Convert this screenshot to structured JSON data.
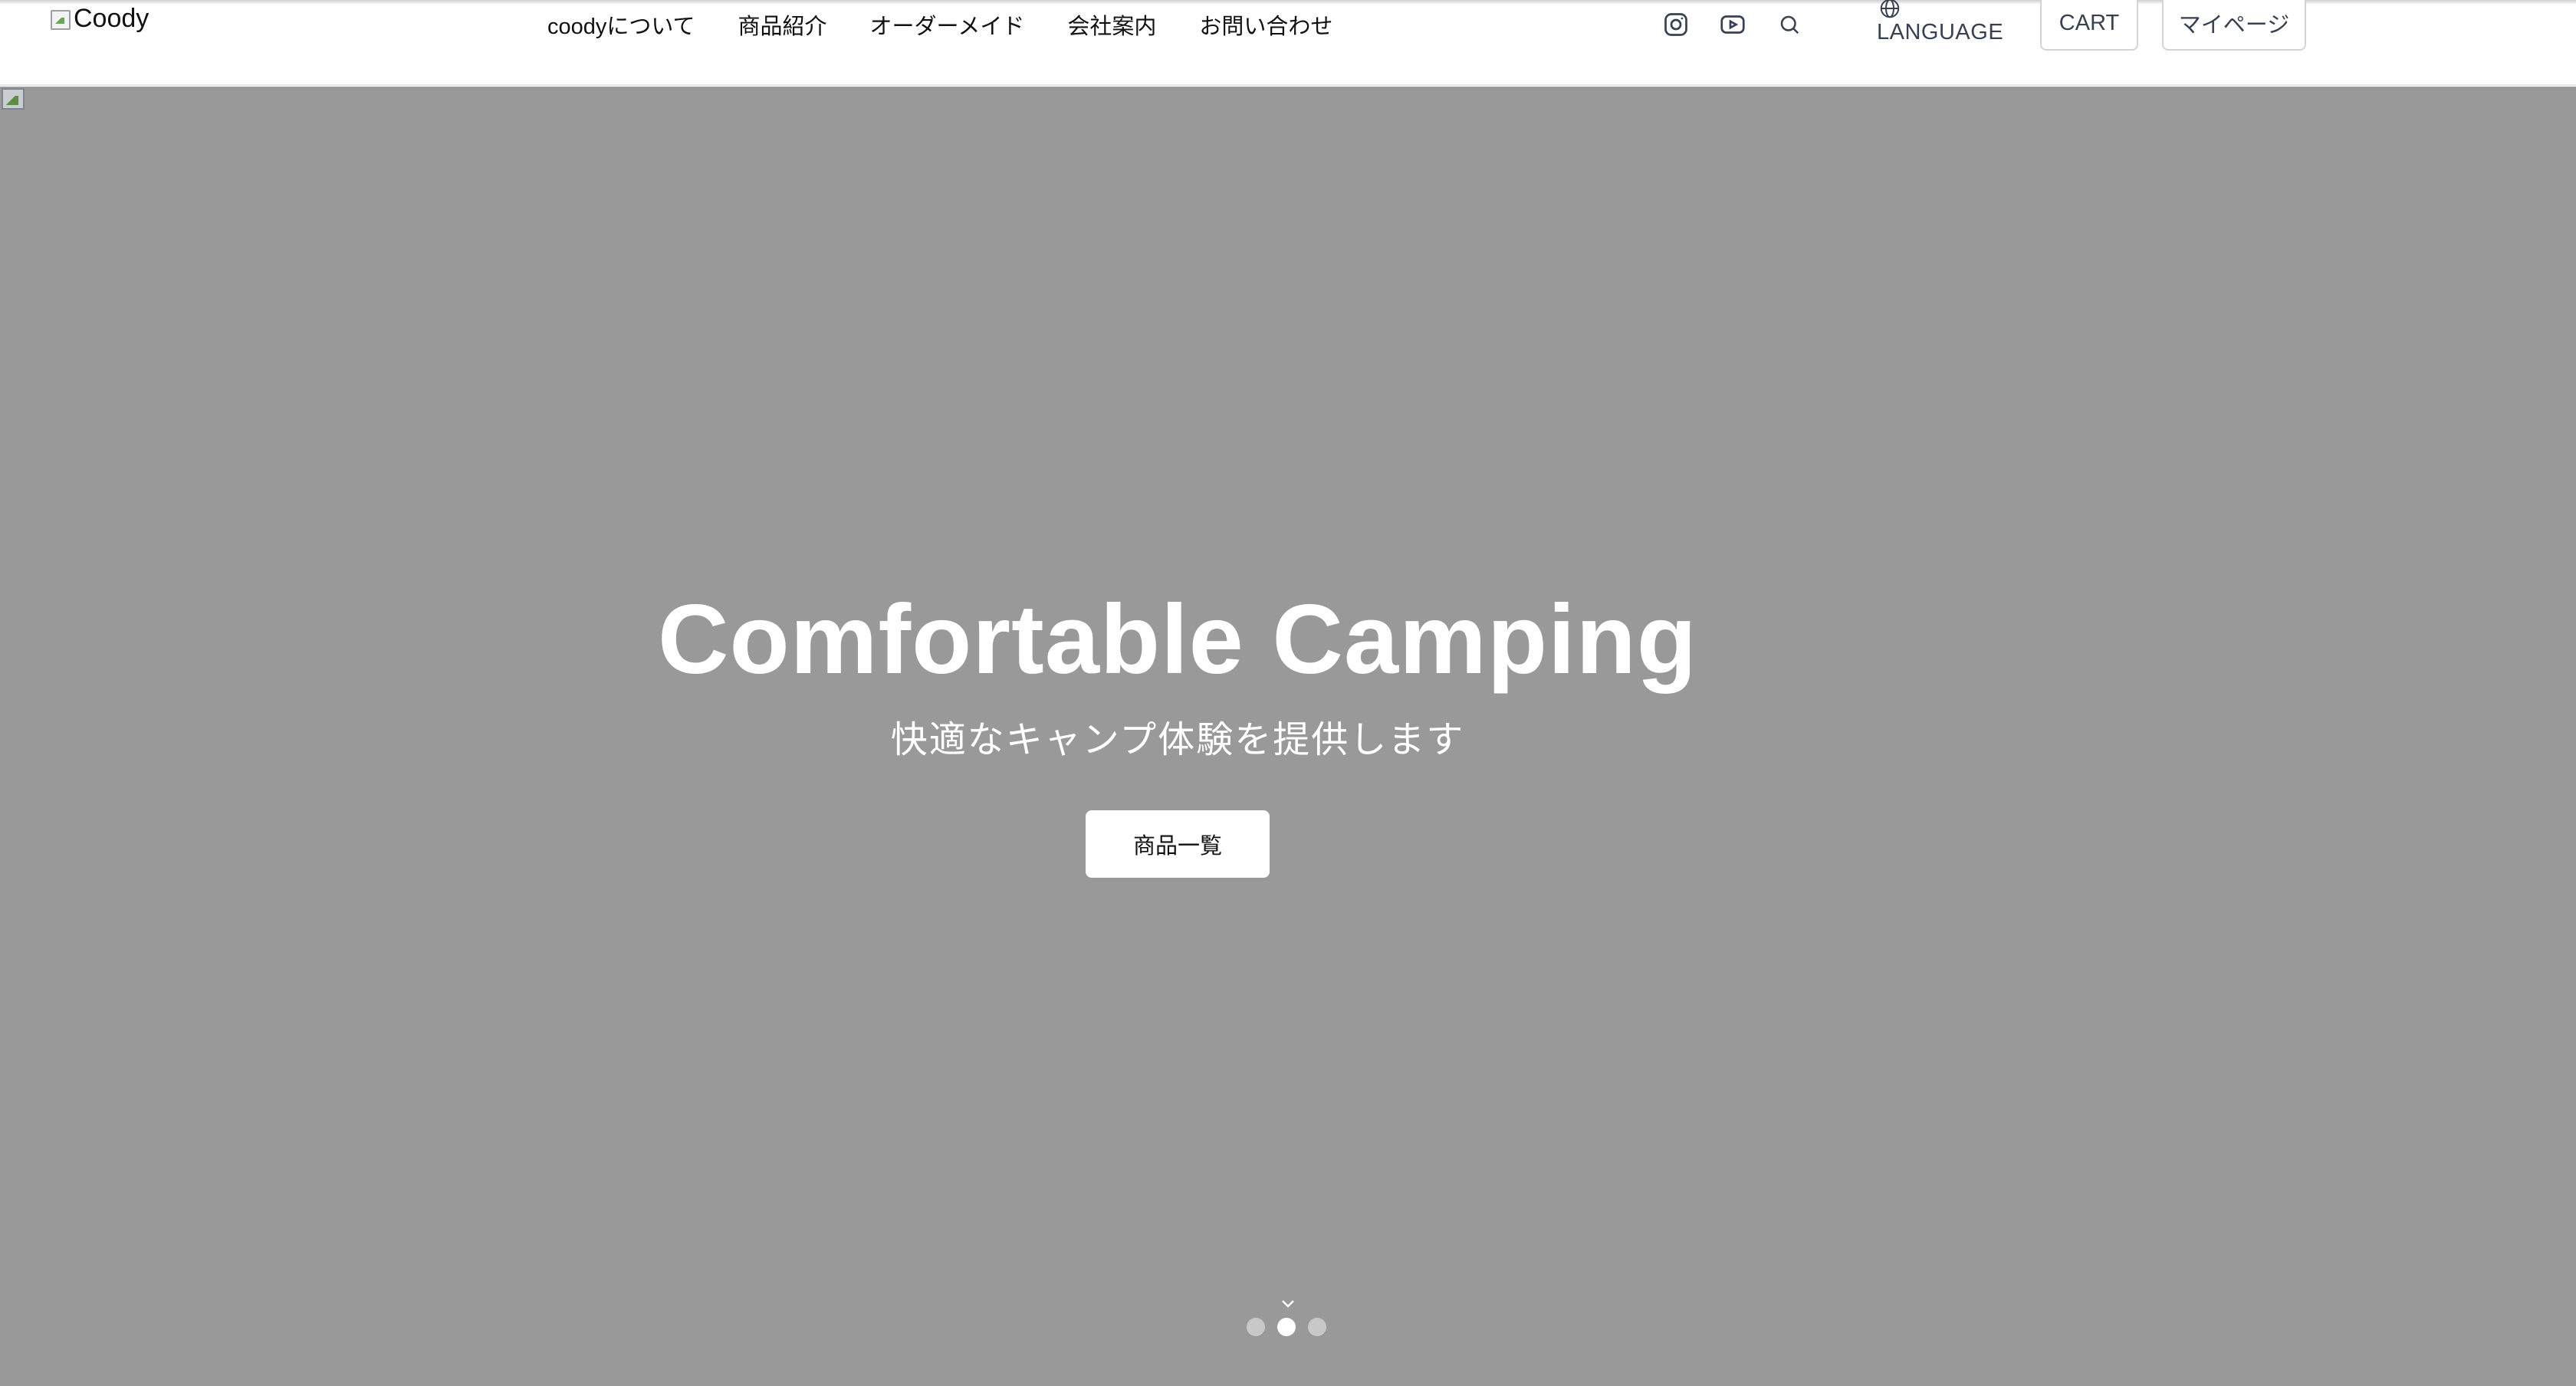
{
  "header": {
    "logo_alt": "Coody",
    "nav": [
      {
        "label": "coodyについて"
      },
      {
        "label": "商品紹介"
      },
      {
        "label": "オーダーメイド"
      },
      {
        "label": "会社案内"
      },
      {
        "label": "お問い合わせ"
      }
    ],
    "social_icons": [
      "instagram-icon",
      "youtube-icon",
      "search-icon"
    ],
    "language_label": "LANGUAGE",
    "cart_label": "CART",
    "mypage_label": "マイページ"
  },
  "hero": {
    "title": "Comfortable Camping",
    "subtitle": "快適なキャンプ体験を提供します",
    "cta_label": "商品一覧",
    "background_color": "#999999",
    "slides_total": 3,
    "active_slide": 2
  }
}
